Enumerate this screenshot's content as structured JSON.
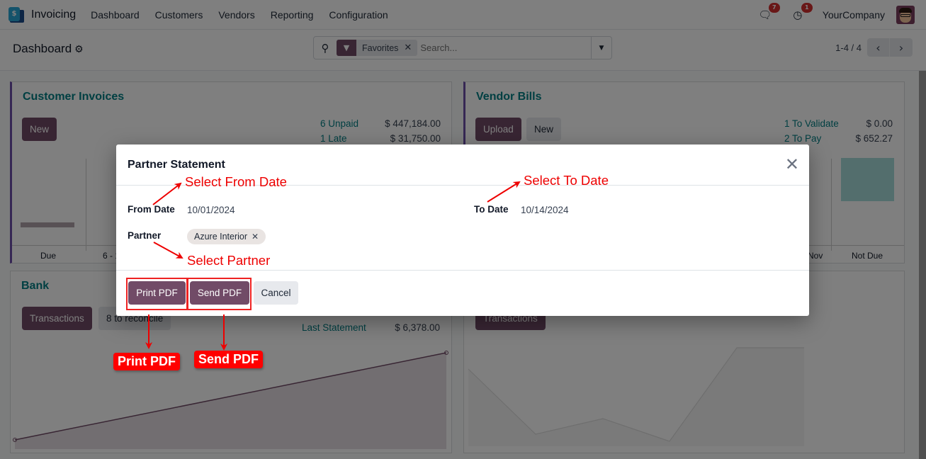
{
  "navbar": {
    "app_name": "Invoicing",
    "menu": [
      "Dashboard",
      "Customers",
      "Vendors",
      "Reporting",
      "Configuration"
    ],
    "messages_count": "7",
    "activities_count": "1",
    "company": "YourCompany"
  },
  "control_panel": {
    "breadcrumb": "Dashboard",
    "search": {
      "facet_label": "Favorites",
      "placeholder": "Search..."
    },
    "pager": "1-4 / 4"
  },
  "cards": {
    "customer_invoices": {
      "title": "Customer Invoices",
      "new_label": "New",
      "stats": [
        {
          "label": "6 Unpaid",
          "value": "$ 447,184.00"
        },
        {
          "label": "1 Late",
          "value": "$ 31,750.00"
        }
      ],
      "axis_labels": [
        "Due",
        "6 - 1"
      ]
    },
    "vendor_bills": {
      "title": "Vendor Bills",
      "upload_label": "Upload",
      "new_label": "New",
      "stats": [
        {
          "label": "1 To Validate",
          "value": "$ 0.00"
        },
        {
          "label": "2 To Pay",
          "value": "$ 652.27"
        }
      ],
      "axis_labels": [
        "Nov",
        "Not Due"
      ]
    },
    "bank": {
      "title": "Bank",
      "transactions_label": "Transactions",
      "reconcile_label": "8 to reconcile",
      "stats": [
        {
          "label": "Last Statement",
          "value": "$ 6,378.00"
        }
      ]
    },
    "cash": {
      "transactions_label": "Transactions"
    }
  },
  "modal": {
    "title": "Partner Statement",
    "from_date_label": "From Date",
    "from_date_value": "10/01/2024",
    "to_date_label": "To Date",
    "to_date_value": "10/14/2024",
    "partner_label": "Partner",
    "partner_tag": "Azure Interior",
    "print_label": "Print PDF",
    "send_label": "Send PDF",
    "cancel_label": "Cancel"
  },
  "annotations": {
    "from_date": "Select From Date",
    "to_date": "Select To Date",
    "partner": "Select Partner",
    "print_tag": "Print PDF",
    "send_tag": "Send PDF"
  }
}
